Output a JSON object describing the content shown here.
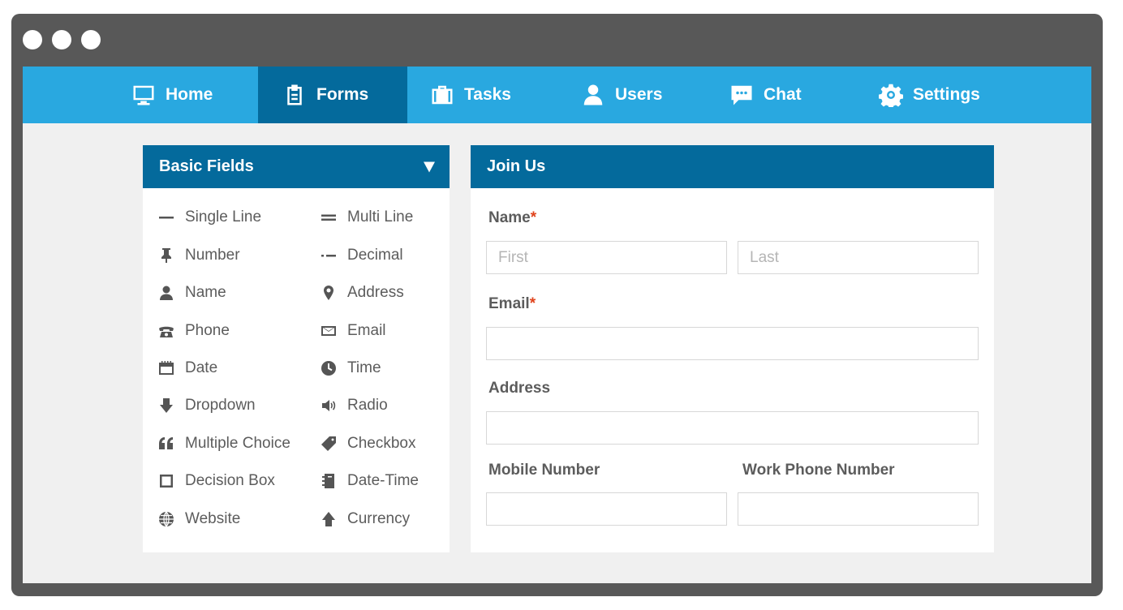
{
  "window": {
    "controls": [
      "close",
      "minimize",
      "maximize"
    ]
  },
  "nav": {
    "items": [
      {
        "label": "Home",
        "icon": "monitor-icon",
        "active": false
      },
      {
        "label": "Forms",
        "icon": "clipboard-icon",
        "active": true
      },
      {
        "label": "Tasks",
        "icon": "briefcase-icon",
        "active": false
      },
      {
        "label": "Users",
        "icon": "user-icon",
        "active": false
      },
      {
        "label": "Chat",
        "icon": "chat-bubble-icon",
        "active": false
      },
      {
        "label": "Settings",
        "icon": "gear-icon",
        "active": false
      }
    ]
  },
  "fields_panel": {
    "title": "Basic Fields",
    "items": [
      {
        "label": "Single Line",
        "icon": "single-line-icon"
      },
      {
        "label": "Multi Line",
        "icon": "multi-line-icon"
      },
      {
        "label": "Number",
        "icon": "pin-icon"
      },
      {
        "label": "Decimal",
        "icon": "decimal-icon"
      },
      {
        "label": "Name",
        "icon": "user-icon"
      },
      {
        "label": "Address",
        "icon": "map-marker-icon"
      },
      {
        "label": "Phone",
        "icon": "telephone-icon"
      },
      {
        "label": "Email",
        "icon": "envelope-icon"
      },
      {
        "label": "Date",
        "icon": "calendar-icon"
      },
      {
        "label": "Time",
        "icon": "clock-icon"
      },
      {
        "label": "Dropdown",
        "icon": "arrow-down-icon"
      },
      {
        "label": "Radio",
        "icon": "speaker-icon"
      },
      {
        "label": "Multiple Choice",
        "icon": "quote-icon"
      },
      {
        "label": "Checkbox",
        "icon": "tag-icon"
      },
      {
        "label": "Decision Box",
        "icon": "square-icon"
      },
      {
        "label": "Date-Time",
        "icon": "notebook-icon"
      },
      {
        "label": "Website",
        "icon": "globe-icon"
      },
      {
        "label": "Currency",
        "icon": "arrow-up-icon"
      }
    ]
  },
  "form": {
    "title": "Join Us",
    "name_label": "Name",
    "required_mark": "*",
    "first_placeholder": "First",
    "last_placeholder": "Last",
    "email_label": "Email",
    "address_label": "Address",
    "mobile_label": "Mobile Number",
    "work_phone_label": "Work Phone Number"
  },
  "colors": {
    "nav_bg": "#29a8e0",
    "nav_active": "#046a9c",
    "panel_header": "#046a9c",
    "required": "#e0431c",
    "window_frame": "#585858"
  }
}
